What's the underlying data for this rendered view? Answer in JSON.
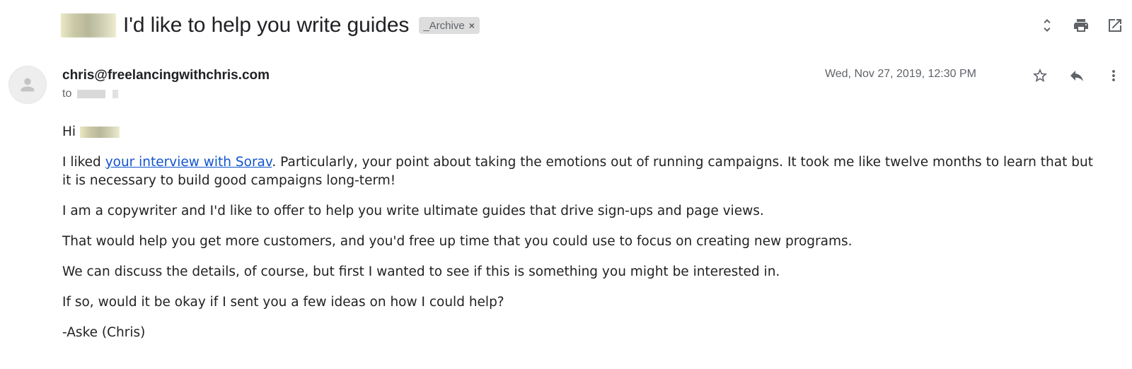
{
  "header": {
    "subject": "I'd like to help you write guides",
    "label": "_Archive",
    "label_remove": "×",
    "actions": [
      {
        "name": "expand-collapse-icon",
        "title": "Expand all"
      },
      {
        "name": "print-icon",
        "title": "Print all"
      },
      {
        "name": "open-new-window-icon",
        "title": "In new window"
      }
    ]
  },
  "message": {
    "sender": "chris@freelancingwithchris.com",
    "to_prefix": "to",
    "date": "Wed, Nov 27, 2019, 12:30 PM",
    "actions": [
      {
        "name": "star-icon",
        "title": "Not starred"
      },
      {
        "name": "reply-icon",
        "title": "Reply"
      },
      {
        "name": "more-options-icon",
        "title": "More"
      }
    ],
    "body": {
      "greeting": "Hi",
      "p1_before": "I liked ",
      "p1_link": "your interview with Sorav",
      "p1_after": ". Particularly, your point about taking the emotions out of running campaigns. It took me like twelve months to learn that but it is necessary to build good campaigns long-term!",
      "p2": "I am a copywriter and I'd like to offer to help you write ultimate guides that drive sign-ups and page views.",
      "p3": "That would help you get more customers, and you'd free up time that you could use to focus on creating new programs.",
      "p4": "We can discuss the details, of course, but first I wanted to see if this is something you might be interested in.",
      "p5": "If so, would it be okay if I sent you a few ideas on how I could help?",
      "signature": "-Aske (Chris)"
    }
  },
  "colors": {
    "link": "#1155cc",
    "icon": "#5f6368",
    "label_bg": "#dddddd"
  }
}
